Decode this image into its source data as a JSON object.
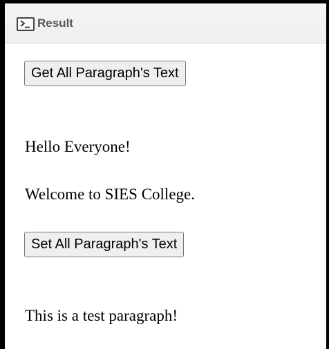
{
  "header": {
    "title": "Result",
    "icon": "terminal-icon"
  },
  "main": {
    "get_button_label": "Get All Paragraph's Text",
    "paragraphs": [
      "Hello Everyone!",
      "Welcome to SIES College."
    ],
    "set_button_label": "Set All Paragraph's Text",
    "output_paragraph": "This is a test paragraph!"
  },
  "colors": {
    "frame_border": "#000000",
    "header_background": "#f1f1f1",
    "header_text": "#555555",
    "button_background": "#efefef",
    "button_border": "#767676"
  }
}
